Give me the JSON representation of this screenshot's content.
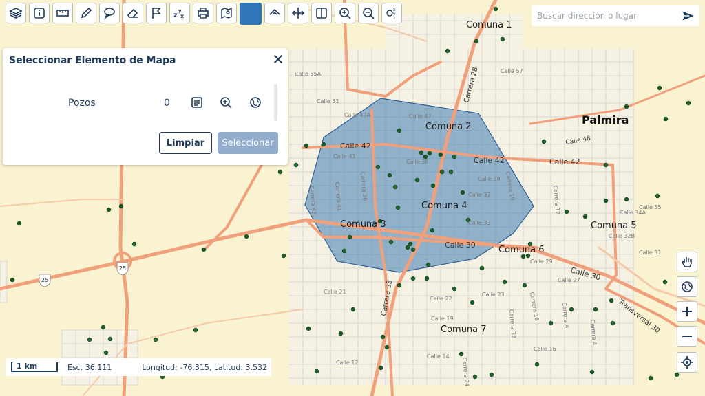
{
  "map": {
    "city_label": "Palmira",
    "comunas": [
      "Comuna 1",
      "Comuna 2",
      "Comuna 3",
      "Comuna 4",
      "Comuna 5",
      "Comuna 6",
      "Comuna 7"
    ],
    "streets": [
      "Calle 42",
      "Calle 42",
      "Calle 42",
      "Calle 30",
      "Calle 30",
      "Calle 48",
      "Carrera 28",
      "Carrera 33",
      "Transversal 30",
      "Calle 37",
      "Calle 33",
      "Calle 23",
      "Calle 22",
      "Calle 19",
      "Calle 14",
      "Calle 47",
      "Calle 57",
      "Calle 55A",
      "Calle 51",
      "Calle 47A",
      "Calle 41",
      "Calle 39",
      "Carrera 43",
      "Carrera 41",
      "Carrera 19",
      "Carrera 12",
      "Calle 34A",
      "Calle 32B",
      "Calle 31",
      "Calle 35",
      "Calle 29",
      "Calle 27",
      "Carrera 16",
      "Carrera 9",
      "Carrera 4",
      "Calle 21",
      "Calle 16",
      "Carrera 32",
      "Calle 12",
      "Carrera 24",
      "Carrera 36",
      "Calle 38"
    ],
    "route_shield": "25",
    "polygon_fill": "#4f86b8",
    "well_color": "#1b5e2a",
    "road_color": "#f0a07a"
  },
  "toolbar": {
    "buttons": [
      "layers",
      "info",
      "measure",
      "draw",
      "comment",
      "erase",
      "flag",
      "xyz",
      "print",
      "map-pin",
      "color",
      "hide-toolbar",
      "pan-toggle",
      "split",
      "zoom-in",
      "zoom-out",
      "coordinates"
    ],
    "active_color": "#2f75b8"
  },
  "search": {
    "placeholder": "Buscar dirección o lugar"
  },
  "panel": {
    "title": "Seleccionar Elemento de Mapa",
    "layer_name": "Pozos",
    "layer_count": "0",
    "clear_label": "Limpiar",
    "select_label": "Seleccionar"
  },
  "status": {
    "scale_label": "1 km",
    "scale_text": "Esc. 36.111",
    "coords_text": "Longitud: -76.315, Latitud: 3.532"
  },
  "map_controls": [
    "hand-pan",
    "globe",
    "zoom-in",
    "zoom-out",
    "locate"
  ]
}
